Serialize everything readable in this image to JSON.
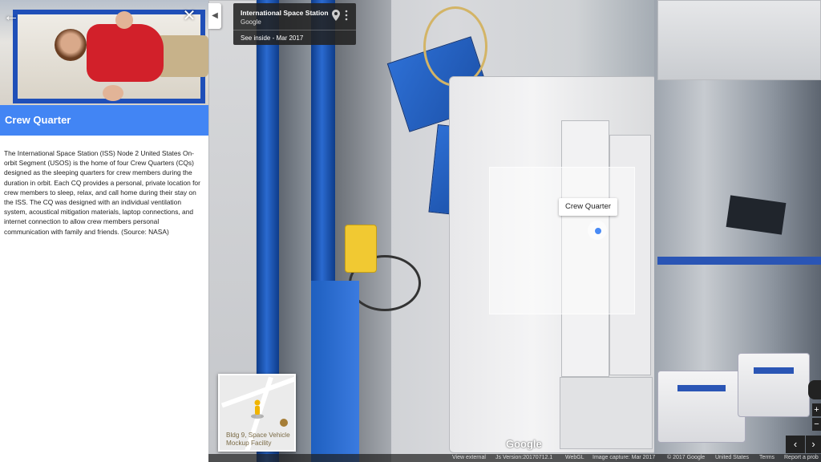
{
  "panel": {
    "title": "Crew Quarter",
    "description": "The International Space Station (ISS) Node 2 United States On-orbit Segment (USOS) is the home of four Crew Quarters (CQs) designed as the sleeping quarters for crew members during the duration in orbit. Each CQ provides a personal, private location for crew members to sleep, relax, and call home during their stay on the ISS. The CQ was designed with an individual ventilation system, acoustical mitigation materials, laptop connections, and internet connection to allow crew members personal communication with family and friends. (Source: NASA)",
    "back_icon": "arrow-left-icon",
    "close_icon": "close-icon"
  },
  "info_card": {
    "title": "International Space Station",
    "subtitle": "Google",
    "date_text": "See inside - Mar 2017",
    "pin_icon": "location-pin-icon",
    "more_icon": "more-vert-icon"
  },
  "hotspot": {
    "label": "Crew Quarter"
  },
  "minimap": {
    "place_label": "Bldg 9, Space Vehicle Mockup Facility"
  },
  "logo": "Google",
  "footer": {
    "view_external": "View external",
    "js_version": "Js Version:20170712.1",
    "webgl": "WebGL",
    "image_capture": "Image capture: Mar 2017",
    "copyright": "© 2017 Google",
    "country": "United States",
    "terms": "Terms",
    "report": "Report a prob"
  },
  "controls": {
    "zoom_in": "+",
    "zoom_out": "−",
    "prev": "‹",
    "next": "›",
    "collapse": "◀"
  },
  "colors": {
    "accent": "#4285f4",
    "hotspot_dot": "#4a8bf5"
  }
}
